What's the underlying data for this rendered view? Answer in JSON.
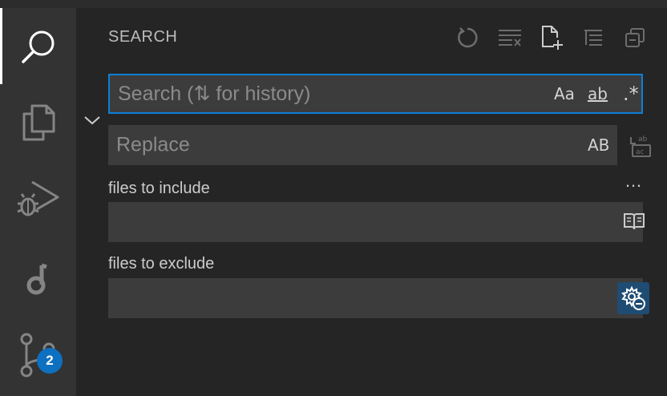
{
  "activitybar": {
    "items": [
      {
        "name": "search",
        "icon": "search-icon"
      },
      {
        "name": "explorer",
        "icon": "files-icon"
      },
      {
        "name": "run-debug",
        "icon": "run-debug-icon"
      },
      {
        "name": "extension",
        "icon": "music-note-icon"
      },
      {
        "name": "source-control",
        "icon": "source-control-icon"
      }
    ],
    "source_control_badge": "2"
  },
  "search_view": {
    "title": "SEARCH",
    "toolbar": [
      "refresh-icon",
      "clear-results-icon",
      "new-search-editor-icon",
      "collapse-all-icon",
      "view-as-tree-icon"
    ],
    "search_input": {
      "value": "",
      "placeholder": "Search (⇅ for history)",
      "options": {
        "match_case": "Aa",
        "whole_word": "ab",
        "regex": ".*"
      }
    },
    "replace_input": {
      "value": "",
      "placeholder": "Replace",
      "preserve_case": "AB"
    },
    "include": {
      "label": "files to include",
      "value": ""
    },
    "exclude": {
      "label": "files to exclude",
      "value": ""
    },
    "more": "…"
  },
  "colors": {
    "accent": "#0e7fd4",
    "badge": "#0e70c0",
    "exclude_button": "#1e4c73"
  }
}
